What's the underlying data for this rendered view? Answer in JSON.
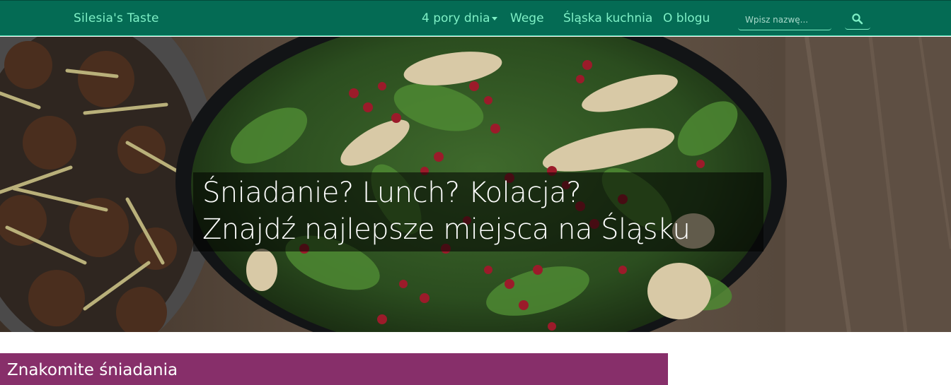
{
  "navbar": {
    "brand": "Silesia's Taste",
    "links": [
      {
        "label": "4 pory dnia",
        "dropdown": true
      },
      {
        "label": "Wege"
      },
      {
        "label": "Śląska kuchnia"
      },
      {
        "label": "O blogu"
      }
    ],
    "search": {
      "placeholder": "Wpisz nazwę...",
      "value": "",
      "icon": "search-icon"
    }
  },
  "hero": {
    "line1": "Śniadanie? Lunch? Kolacja?",
    "line2": "Znajdź najlepsze miejsca na Śląsku"
  },
  "section": {
    "title": "Znakomite śniadania"
  },
  "colors": {
    "navbar_bg": "#046b54",
    "navbar_text": "#7ff0c6",
    "section_bg": "#872f6a",
    "caption_bg": "rgba(0,0,0,0.55)"
  }
}
